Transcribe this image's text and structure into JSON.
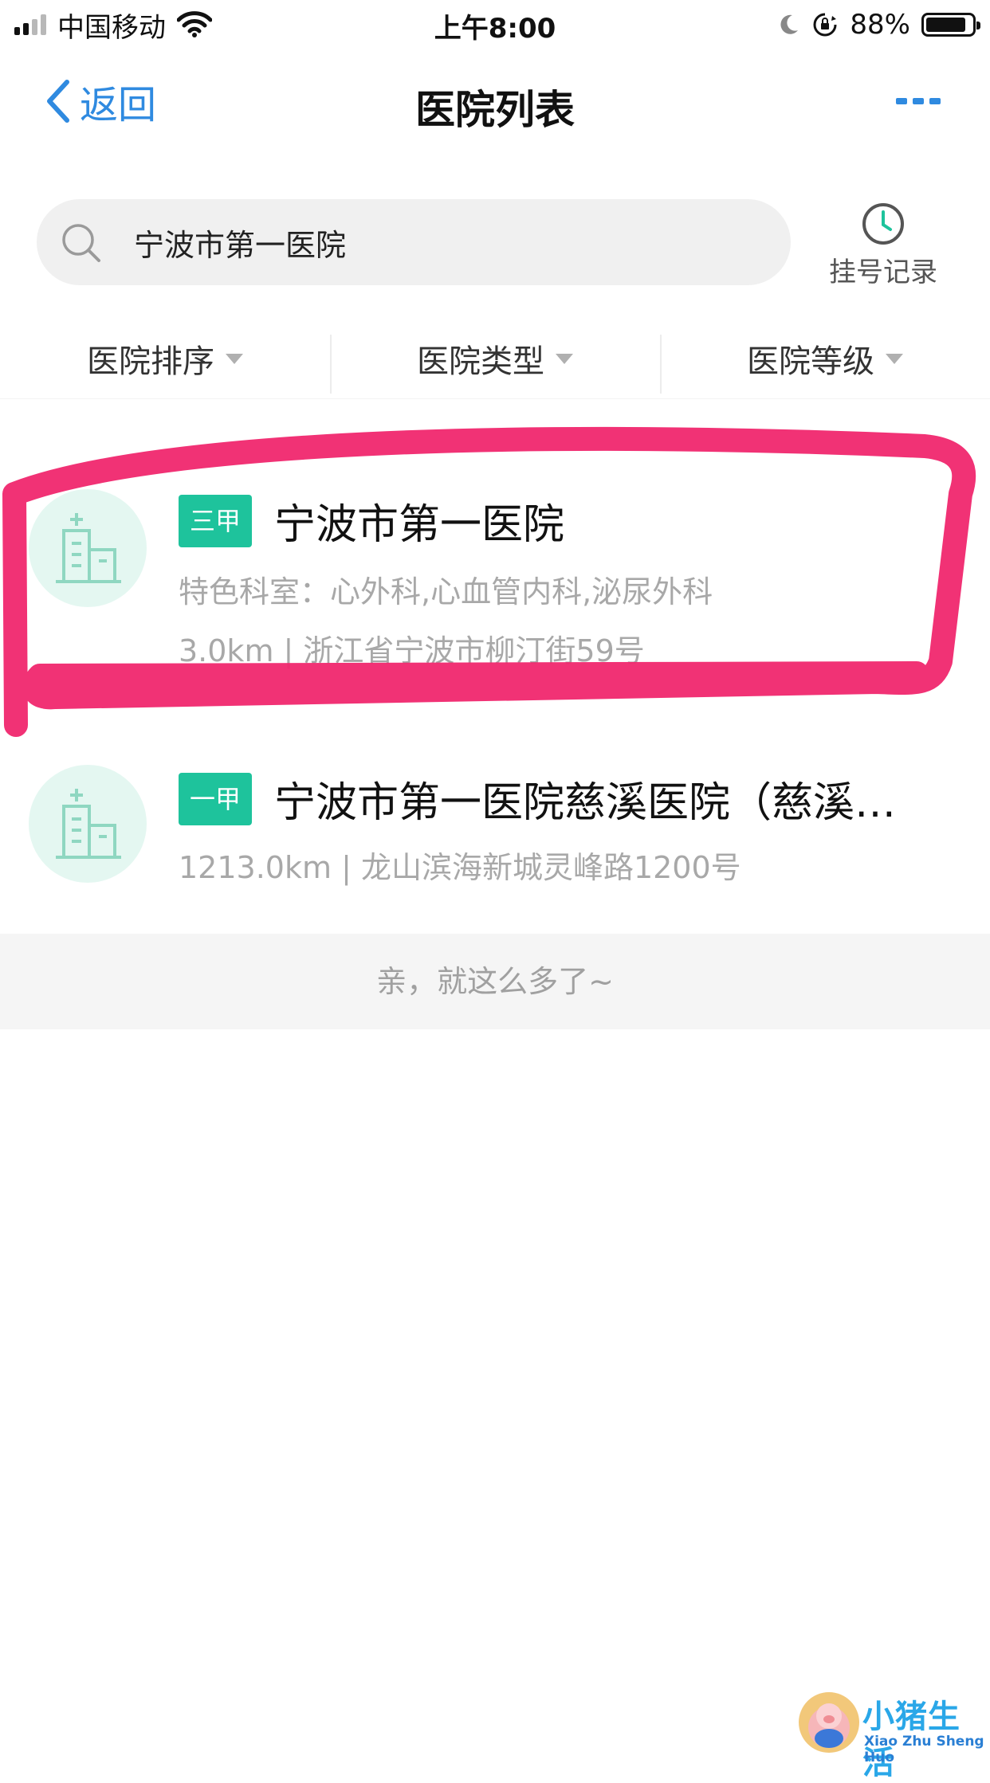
{
  "status_bar": {
    "carrier": "中国移动",
    "time": "上午8:00",
    "battery_percent": "88%",
    "battery_level": 0.88,
    "icons": [
      "signal-icon",
      "wifi-icon",
      "moon-icon",
      "orientation-lock-icon",
      "battery-icon"
    ]
  },
  "nav": {
    "back_label": "返回",
    "title": "医院列表",
    "more_icon": "more-icon"
  },
  "search": {
    "value": "宁波市第一医院",
    "icon": "search-icon"
  },
  "record": {
    "label": "挂号记录",
    "icon": "clock-icon"
  },
  "filters": [
    {
      "label": "医院排序"
    },
    {
      "label": "医院类型"
    },
    {
      "label": "医院等级"
    }
  ],
  "hospitals": [
    {
      "grade": "三甲",
      "name": "宁波市第一医院",
      "specialties": "特色科室：心外科,心血管内科,泌尿外科",
      "address_line": "3.0km | 浙江省宁波市柳汀街59号"
    },
    {
      "grade": "一甲",
      "name": "宁波市第一医院慈溪医院（慈溪…",
      "address_line": "1213.0km | 龙山滨海新城灵峰路1200号"
    }
  ],
  "footer_note": "亲，就这么多了~",
  "watermark": {
    "title": "小猪生活",
    "subtitle": "Xiao Zhu Sheng Huo"
  },
  "colors": {
    "accent_blue": "#2f8ae0",
    "grade_green": "#1ec39c",
    "highlight_pink": "#f0276e",
    "avatar_bg": "#e4f7f1"
  }
}
